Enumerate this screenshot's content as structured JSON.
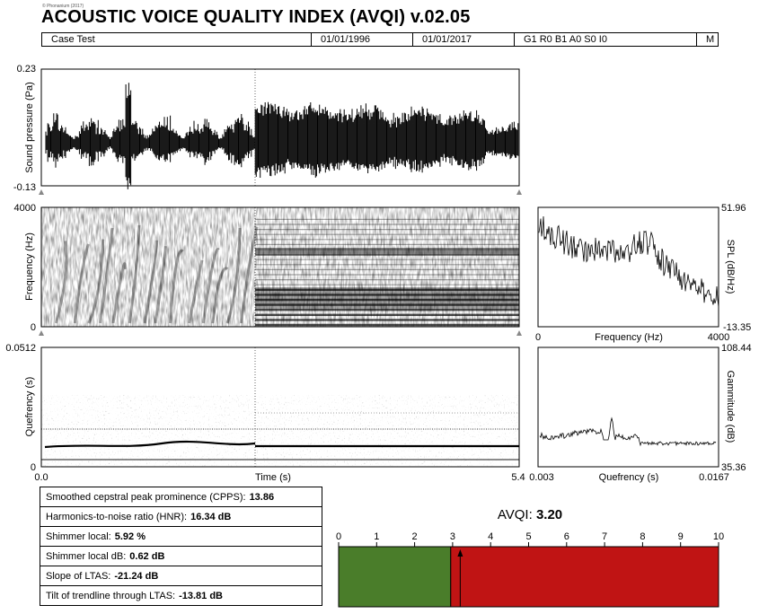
{
  "header": {
    "copyright": "© Phonanium (2017)",
    "title": "ACOUSTIC VOICE QUALITY INDEX (AVQI) v.02.05",
    "fields": [
      "Case Test",
      "01/01/1996",
      "01/01/2017",
      "G1 R0 B1 A0 S0 I0",
      "M"
    ]
  },
  "chart_data": [
    {
      "type": "line",
      "name": "oscillogram",
      "ylabel": "Sound pressure (Pa)",
      "ylim": [
        -0.13,
        0.23
      ],
      "y_ticks": [
        "0.23",
        "-0.13"
      ]
    },
    {
      "type": "heatmap",
      "name": "spectrogram",
      "ylabel": "Frequency (Hz)",
      "ylim": [
        0,
        4000
      ],
      "y_ticks": [
        "4000",
        "0"
      ]
    },
    {
      "type": "line",
      "name": "ltas",
      "xlabel": "Frequency (Hz)",
      "ylabel": "SPL (dB/Hz)",
      "xlim": [
        0,
        4000
      ],
      "ylim": [
        -13.35,
        51.96
      ],
      "x_ticks": [
        "0",
        "4000"
      ],
      "y_ticks": [
        "51.96",
        "-13.35"
      ]
    },
    {
      "type": "heatmap",
      "name": "cepstrogram",
      "xlabel": "Time (s)",
      "ylabel": "Quefrency (s)",
      "xlim": [
        0.0,
        5.4
      ],
      "ylim": [
        0,
        0.0512
      ],
      "x_ticks": [
        "0.0",
        "5.4"
      ],
      "y_ticks": [
        "0.0512",
        "0"
      ]
    },
    {
      "type": "line",
      "name": "cepstrum",
      "xlabel": "Quefrency (s)",
      "ylabel": "Gammitude (dB)",
      "xlim": [
        0.003,
        0.0167
      ],
      "ylim": [
        35.36,
        108.44
      ],
      "x_ticks": [
        "0.003",
        "0.0167"
      ],
      "y_ticks": [
        "108.44",
        "35.36"
      ]
    },
    {
      "type": "bar",
      "name": "avqi-scale",
      "title": "AVQI: 3.20",
      "value": 3.2,
      "threshold": 2.95,
      "xlim": [
        0,
        10
      ],
      "ticks": [
        "0",
        "1",
        "2",
        "3",
        "4",
        "5",
        "6",
        "7",
        "8",
        "9",
        "10"
      ],
      "colors": {
        "normal": "#4a7d2a",
        "pathological": "#c01414"
      }
    }
  ],
  "measures": [
    {
      "label": "Smoothed cepstral peak prominence (CPPS):",
      "value": "13.86"
    },
    {
      "label": "Harmonics-to-noise ratio (HNR):",
      "value": "16.34 dB"
    },
    {
      "label": "Shimmer local:",
      "value": "5.92 %"
    },
    {
      "label": "Shimmer local dB:",
      "value": "0.62 dB"
    },
    {
      "label": "Slope of LTAS:",
      "value": "-21.24 dB"
    },
    {
      "label": "Tilt of trendline through LTAS:",
      "value": "-13.81 dB"
    }
  ],
  "avqi": {
    "label": "AVQI:",
    "value": "3.20"
  }
}
